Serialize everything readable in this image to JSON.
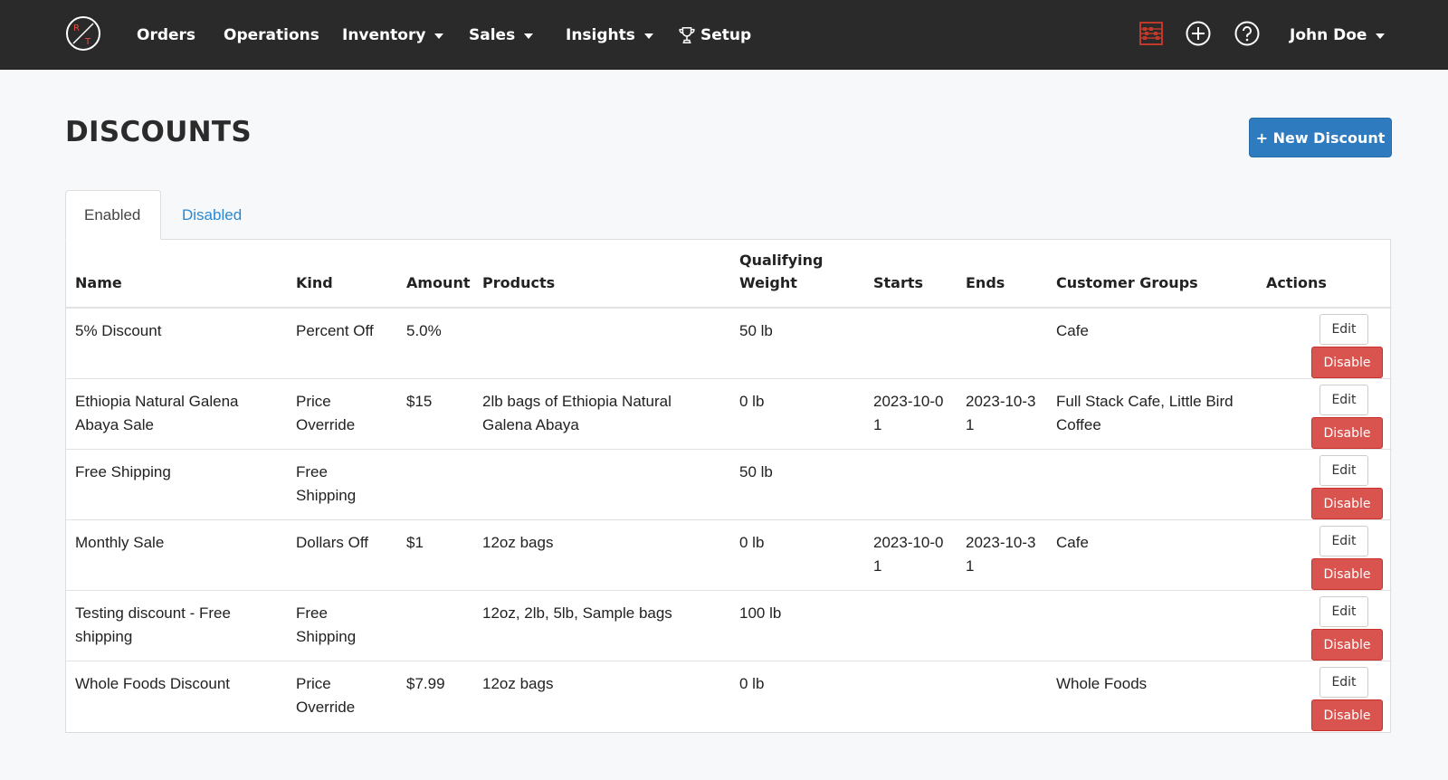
{
  "navbar": {
    "logo_name": "roastery-logo",
    "items": [
      {
        "label": "Orders",
        "dropdown": false
      },
      {
        "label": "Operations",
        "dropdown": false
      },
      {
        "label": "Inventory",
        "dropdown": true
      },
      {
        "label": "Sales",
        "dropdown": true
      },
      {
        "label": "Insights",
        "dropdown": true
      },
      {
        "label": "Setup",
        "dropdown": false,
        "icon": "trophy-icon"
      }
    ],
    "icons": [
      "abacus-icon",
      "plus-circle-icon",
      "help-circle-icon"
    ],
    "user_label": "John Doe"
  },
  "page": {
    "title": "DISCOUNTS",
    "new_button_label": "+ New Discount"
  },
  "tabs": [
    {
      "label": "Enabled",
      "active": true
    },
    {
      "label": "Disabled",
      "active": false
    }
  ],
  "table": {
    "headers": {
      "name": "Name",
      "kind": "Kind",
      "amount": "Amount",
      "products": "Products",
      "qualifying_weight_1": "Qualifying",
      "qualifying_weight_2": "Weight",
      "starts": "Starts",
      "ends": "Ends",
      "customer_groups": "Customer Groups",
      "actions": "Actions"
    },
    "edit_label": "Edit",
    "disable_label": "Disable",
    "rows": [
      {
        "name": "5% Discount",
        "kind": "Percent Off",
        "amount": "5.0%",
        "products": "",
        "weight": "50 lb",
        "starts": "",
        "ends": "",
        "groups": "Cafe"
      },
      {
        "name": "Ethiopia Natural Galena Abaya Sale",
        "kind": "Price Override",
        "amount": "$15",
        "products": "2lb bags of Ethiopia Natural Galena Abaya",
        "weight": "0 lb",
        "starts": "2023-10-01",
        "ends": "2023-10-31",
        "groups": "Full Stack Cafe, Little Bird Coffee"
      },
      {
        "name": "Free Shipping",
        "kind": "Free Shipping",
        "amount": "",
        "products": "",
        "weight": "50 lb",
        "starts": "",
        "ends": "",
        "groups": ""
      },
      {
        "name": "Monthly Sale",
        "kind": "Dollars Off",
        "amount": "$1",
        "products": "12oz bags",
        "weight": "0 lb",
        "starts": "2023-10-01",
        "ends": "2023-10-31",
        "groups": "Cafe"
      },
      {
        "name": "Testing discount - Free shipping",
        "kind": "Free Shipping",
        "amount": "",
        "products": "12oz, 2lb, 5lb, Sample bags",
        "weight": "100 lb",
        "starts": "",
        "ends": "",
        "groups": ""
      },
      {
        "name": "Whole Foods Discount",
        "kind": "Price Override",
        "amount": "$7.99",
        "products": "12oz bags",
        "weight": "0 lb",
        "starts": "",
        "ends": "",
        "groups": "Whole Foods"
      }
    ]
  },
  "colors": {
    "navbar_bg": "#2a2a2a",
    "primary": "#2f7bbf",
    "danger": "#d9534f",
    "link": "#2a88d0",
    "abacus": "#c0392b"
  }
}
